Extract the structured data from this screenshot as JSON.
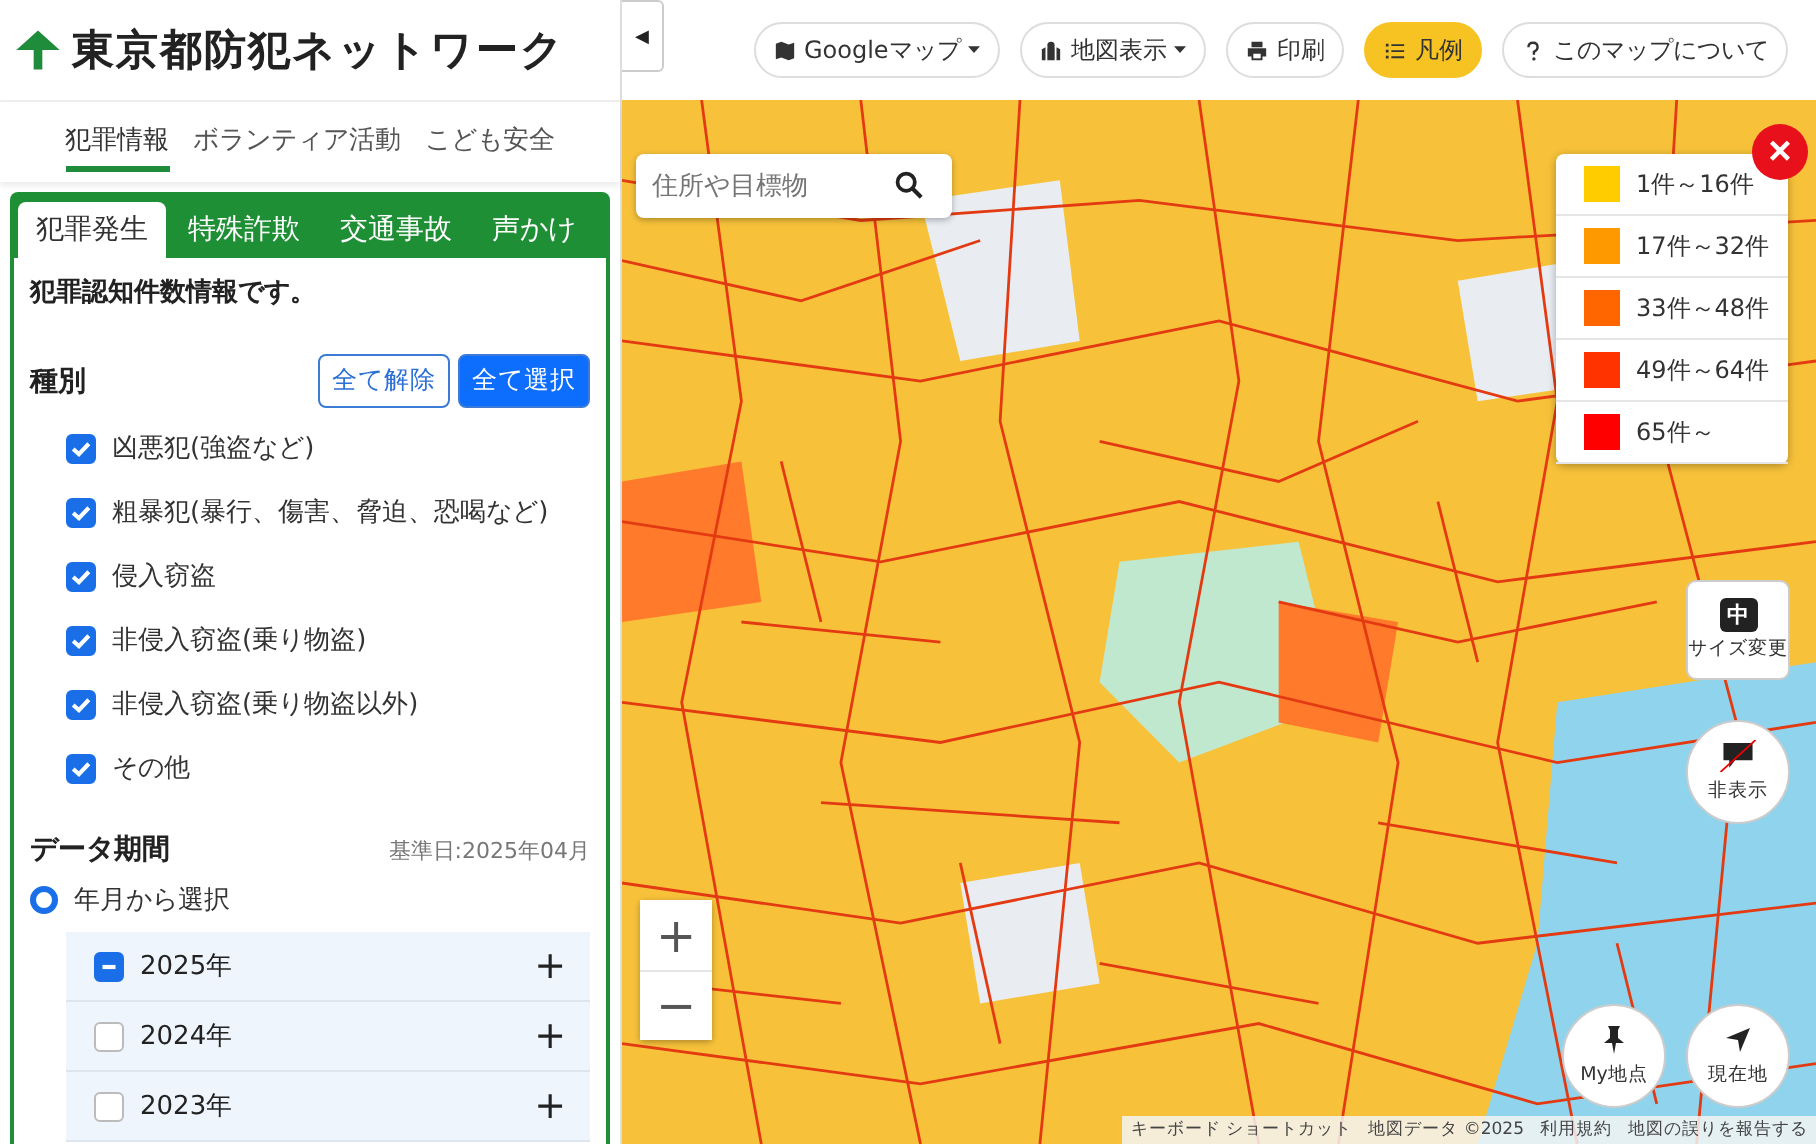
{
  "logo": {
    "text": "東京都防犯ネットワーク"
  },
  "nav_tabs": [
    {
      "label": "犯罪情報",
      "selected": true
    },
    {
      "label": "ボランティア活動",
      "selected": false
    },
    {
      "label": "こども安全",
      "selected": false
    }
  ],
  "category_tabs": [
    {
      "label": "犯罪発生",
      "selected": true
    },
    {
      "label": "特殊詐欺",
      "selected": false
    },
    {
      "label": "交通事故",
      "selected": false
    },
    {
      "label": "声かけ",
      "selected": false
    }
  ],
  "description": "犯罪認知件数情報です。",
  "types": {
    "title": "種別",
    "clear_button": "全て解除",
    "select_all_button": "全て選択",
    "items": [
      {
        "label": "凶悪犯(強盗など)",
        "checked": true
      },
      {
        "label": "粗暴犯(暴行、傷害、脅迫、恐喝など)",
        "checked": true
      },
      {
        "label": "侵入窃盗",
        "checked": true
      },
      {
        "label": "非侵入窃盗(乗り物盗)",
        "checked": true
      },
      {
        "label": "非侵入窃盗(乗り物盗以外)",
        "checked": true
      },
      {
        "label": "その他",
        "checked": true
      }
    ]
  },
  "period": {
    "title": "データ期間",
    "base_date": "基準日:2025年04月",
    "radio": {
      "label": "年月から選択",
      "selected": true
    },
    "years": [
      {
        "label": "2025年",
        "partially_checked": true,
        "expand": "+"
      },
      {
        "label": "2024年",
        "partially_checked": false,
        "expand": "+"
      },
      {
        "label": "2023年",
        "partially_checked": false,
        "expand": "+"
      }
    ]
  },
  "collapse_button": "◀",
  "toolbar": [
    {
      "label": "Googleマップ",
      "dropdown": true,
      "selected": false
    },
    {
      "label": "地図表示",
      "dropdown": true,
      "selected": false
    },
    {
      "label": "印刷",
      "dropdown": false,
      "selected": false
    },
    {
      "label": "凡例",
      "dropdown": false,
      "selected": true
    },
    {
      "label": "このマップについて",
      "dropdown": false,
      "selected": false
    }
  ],
  "search": {
    "placeholder": "住所や目標物"
  },
  "legend": {
    "close": "×",
    "items": [
      {
        "label": "1件～16件",
        "color": "#ffcc00"
      },
      {
        "label": "17件～32件",
        "color": "#ff9900"
      },
      {
        "label": "33件～48件",
        "color": "#ff6600"
      },
      {
        "label": "49件～64件",
        "color": "#ff3300"
      },
      {
        "label": "65件～",
        "color": "#ff0000"
      }
    ]
  },
  "size_button": {
    "glyph": "中",
    "label": "サイズ変更"
  },
  "hide_button": {
    "label": "非表示"
  },
  "zoom": {
    "in": "+",
    "out": "−"
  },
  "my_place_button": "My地点",
  "current_location_button": "現在地",
  "attribution": [
    "キーボード ショートカット",
    "地図データ ©2025",
    "利用規約",
    "地図の誤りを報告する"
  ]
}
